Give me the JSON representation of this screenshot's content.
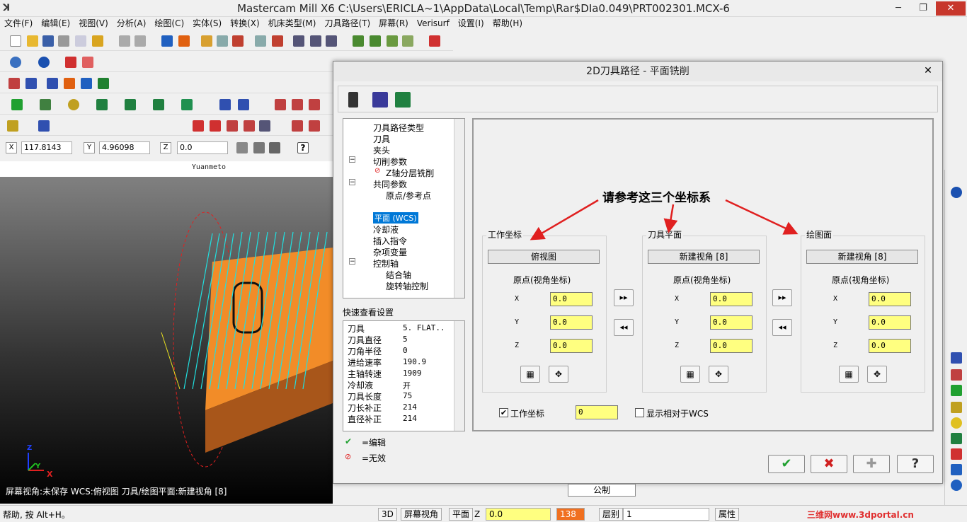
{
  "window": {
    "title": "Mastercam Mill X6  C:\\Users\\ERICLA~1\\AppData\\Local\\Temp\\Rar$DIa0.049\\PRT002301.MCX-6",
    "min": "─",
    "max": "❐",
    "close": "✕"
  },
  "menu": [
    "文件(F)",
    "编辑(E)",
    "视图(V)",
    "分析(A)",
    "绘图(C)",
    "实体(S)",
    "转换(X)",
    "机床类型(M)",
    "刀具路径(T)",
    "屏幕(R)",
    "Verisurf",
    "设置(I)",
    "帮助(H)"
  ],
  "coords": {
    "x_label": "X",
    "x_value": "117.8143",
    "y_label": "Y",
    "y_value": "4.96098",
    "z_label": "Z",
    "z_value": "0.0"
  },
  "viewport": {
    "label": "Yuanmeto",
    "status": "屏幕视角:未保存    WCS:俯视图    刀具/绘图平面:新建视角 [8]",
    "axis_x": "X",
    "axis_y": "Y",
    "axis_z": "Z"
  },
  "dialog": {
    "title": "2D刀具路径 - 平面铣削",
    "close": "✕",
    "tree": [
      "刀具路径类型",
      "刀具",
      "夹头",
      "切削参数",
      "Z轴分层铣削",
      "共同参数",
      "原点/参考点",
      "平面 (WCS)",
      "冷却液",
      "插入指令",
      "杂项变量",
      "控制轴",
      "结合轴",
      "旋转轴控制"
    ],
    "quick_view_label": "快速查看设置",
    "quick_view": [
      {
        "k": "刀具",
        "v": "5. FLAT.."
      },
      {
        "k": "刀具直径",
        "v": "5"
      },
      {
        "k": "刀角半径",
        "v": "0"
      },
      {
        "k": "进给速率",
        "v": "190.9"
      },
      {
        "k": "主轴转速",
        "v": "1909"
      },
      {
        "k": "冷却液",
        "v": "开"
      },
      {
        "k": "刀具长度",
        "v": "75"
      },
      {
        "k": "刀长补正",
        "v": "214"
      },
      {
        "k": "直径补正",
        "v": "214"
      }
    ],
    "legend_edit": "=编辑",
    "legend_invalid": "=无效",
    "annotation": "请参考这三个坐标系",
    "groups": [
      {
        "title": "工作坐标",
        "view": "俯视图",
        "origin_label": "原点(视角坐标)",
        "x": "0.0",
        "y": "0.0",
        "z": "0.0"
      },
      {
        "title": "刀具平面",
        "view": "新建视角 [8]",
        "origin_label": "原点(视角坐标)",
        "x": "0.0",
        "y": "0.0",
        "z": "0.0"
      },
      {
        "title": "绘图面",
        "view": "新建视角 [8]",
        "origin_label": "原点(视角坐标)",
        "x": "0.0",
        "y": "0.0",
        "z": "0.0"
      }
    ],
    "axis_labels": [
      "X",
      "Y",
      "Z"
    ],
    "wcs_check_label": "工作坐标",
    "wcs_value": "0",
    "show_rel_label": "显示相对于WCS",
    "ok": "✔",
    "cancel": "✖",
    "add": "✚",
    "help": "?",
    "arrow_right": "▸▸",
    "arrow_left": "◂◂"
  },
  "bottom": {
    "help": "帮助, 按 Alt+H。",
    "btn_3d": "3D",
    "btn_screenview": "屏幕视角",
    "btn_plane": "平面",
    "z_label": "Z",
    "z_value": "0.0",
    "color_value": "138",
    "level_label": "层别",
    "level_value": "1",
    "attr_label": "属性",
    "tab_label": "公制",
    "watermark": "三维网www.3dportal.cn"
  },
  "colors": {
    "accent": "#0078d7",
    "field_yellow": "#ffff80",
    "arrow_red": "#e02020",
    "part_orange": "#f28c28"
  }
}
